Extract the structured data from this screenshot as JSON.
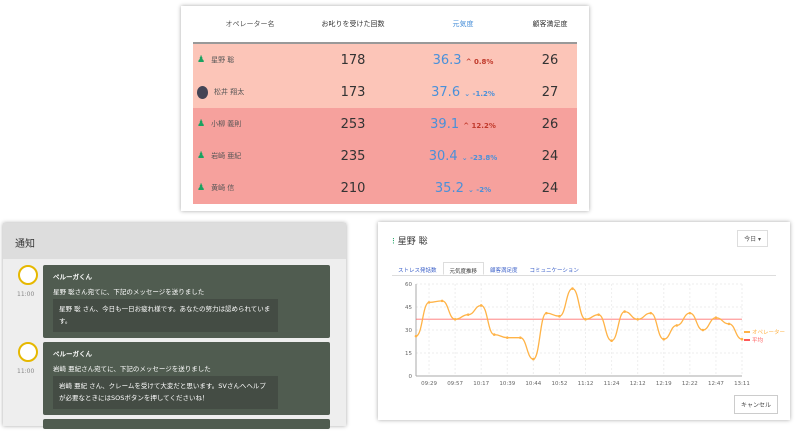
{
  "table": {
    "headers": [
      "オペレーター名",
      "お叱りを受けた回数",
      "元気度",
      "顧客満足度"
    ],
    "rows": [
      {
        "name": "星野 聡",
        "scolded": "178",
        "genki": "36.3",
        "change": "^ 0.8%",
        "dir": "up",
        "satisfaction": "26",
        "bg": "#fcc5b8",
        "avatar": "person"
      },
      {
        "name": "松井 翔太",
        "scolded": "173",
        "genki": "37.6",
        "change": "⌄ -1.2%",
        "dir": "down",
        "satisfaction": "27",
        "bg": "#fcc5b8",
        "avatar": "photo"
      },
      {
        "name": "小柳 義則",
        "scolded": "253",
        "genki": "39.1",
        "change": "^ 12.2%",
        "dir": "up",
        "satisfaction": "26",
        "bg": "#f6a19d",
        "avatar": "person"
      },
      {
        "name": "岩崎 亜紀",
        "scolded": "235",
        "genki": "30.4",
        "change": "⌄ -23.8%",
        "dir": "down",
        "satisfaction": "24",
        "bg": "#f6a19d",
        "avatar": "person"
      },
      {
        "name": "黄崎 信",
        "scolded": "210",
        "genki": "35.2",
        "change": "⌄ -2%",
        "dir": "down",
        "satisfaction": "24",
        "bg": "#f6a19d",
        "avatar": "person"
      }
    ]
  },
  "notifications": {
    "title": "通知",
    "items": [
      {
        "sender": "ペルーガくん",
        "time": "11:00",
        "summary": "星野 聡さん宛てに、下記のメッセージを送りました",
        "body": "星野 聡 さん、今日も一日お疲れ様です。あなたの努力は認められています。"
      },
      {
        "sender": "ペルーガくん",
        "time": "11:00",
        "summary": "岩崎 亜紀さん宛てに、下記のメッセージを送りました",
        "body": "岩崎 亜紀 さん、クレームを受けて大変だと思います。SVさんへヘルプが必要なときにはSOSボタンを押してくださいね！"
      }
    ]
  },
  "detail": {
    "operator": "星野 聡",
    "period": "今日 ▾",
    "tabs": [
      "ストレス発話数",
      "元気度推移",
      "顧客満足度",
      "コミュニケーション"
    ],
    "active_tab": 1,
    "cancel": "キャンセル"
  },
  "chart_data": {
    "type": "line",
    "yticks": [
      "0",
      "15",
      "30",
      "45",
      "60"
    ],
    "ylim": [
      0,
      60
    ],
    "xticks": [
      "09:29",
      "09:57",
      "10:17",
      "10:39",
      "10:44",
      "10:52",
      "11:12",
      "11:24",
      "12:12",
      "12:19",
      "12:22",
      "12:47",
      "13:11"
    ],
    "series": [
      {
        "name": "オペレーター",
        "color": "#ffb347",
        "values": [
          26,
          48,
          49,
          37,
          40,
          46,
          27,
          25,
          25,
          11,
          41,
          39,
          57,
          37,
          40,
          23,
          42,
          37,
          41,
          24,
          33,
          41,
          30,
          38,
          34,
          24
        ]
      },
      {
        "name": "平均",
        "color": "#ff5a5a",
        "values": [
          37
        ]
      }
    ],
    "grid": true,
    "legend": "right"
  }
}
